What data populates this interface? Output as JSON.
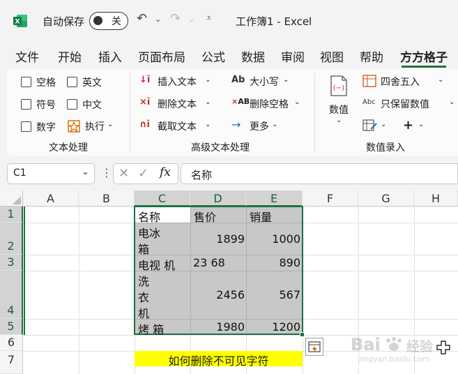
{
  "titlebar": {
    "autosave_label": "自动保存",
    "autosave_state": "关",
    "title": "工作簿1  -  Excel"
  },
  "menu": [
    "文件",
    "开始",
    "插入",
    "页面布局",
    "公式",
    "数据",
    "审阅",
    "视图",
    "帮助",
    "方方格子"
  ],
  "ribbon": {
    "text_group": {
      "checkboxes": [
        "空格",
        "英文",
        "符号",
        "中文",
        "数字"
      ],
      "execute": "执行",
      "label": "文本处理"
    },
    "advanced_group": {
      "insert_text": "插入文本",
      "delete_text": "删除文本",
      "cut_text": "截取文本",
      "case": "大小写",
      "delete_spaces": "删除空格",
      "more": "更多",
      "label": "高级文本处理"
    },
    "number_group": {
      "value": "数值",
      "round": "四舍五入",
      "keep_values": "只保留数值",
      "label": "数值录入"
    }
  },
  "formula_bar": {
    "name_box": "C1",
    "fx": "fx",
    "content": "名称"
  },
  "grid": {
    "columns": [
      "A",
      "B",
      "C",
      "D",
      "E",
      "F",
      "G",
      "H"
    ],
    "rows": [
      "1",
      "2",
      "3",
      "4",
      "5",
      "6",
      "7"
    ],
    "table": {
      "headers": [
        "名称",
        "售价",
        "销量"
      ],
      "rows": [
        {
          "name_lines": [
            "电冰",
            "箱"
          ],
          "price": "1899",
          "sales": "1000"
        },
        {
          "name_lines": [
            "电视 机"
          ],
          "price": "23 68",
          "sales": "890"
        },
        {
          "name_lines": [
            "洗",
            "衣",
            "机"
          ],
          "price": "2456",
          "sales": "567"
        },
        {
          "name_lines": [
            "烤 箱"
          ],
          "price": "1980",
          "sales": "1200"
        }
      ]
    },
    "note": "如何删除不可见字符"
  },
  "watermark": {
    "brand": "Bai经验",
    "url": "jingyan.baidu.com"
  },
  "colors": {
    "excel_green": "#1e7145",
    "selection": "#c8c8c8",
    "note_bg": "#ffff00"
  }
}
